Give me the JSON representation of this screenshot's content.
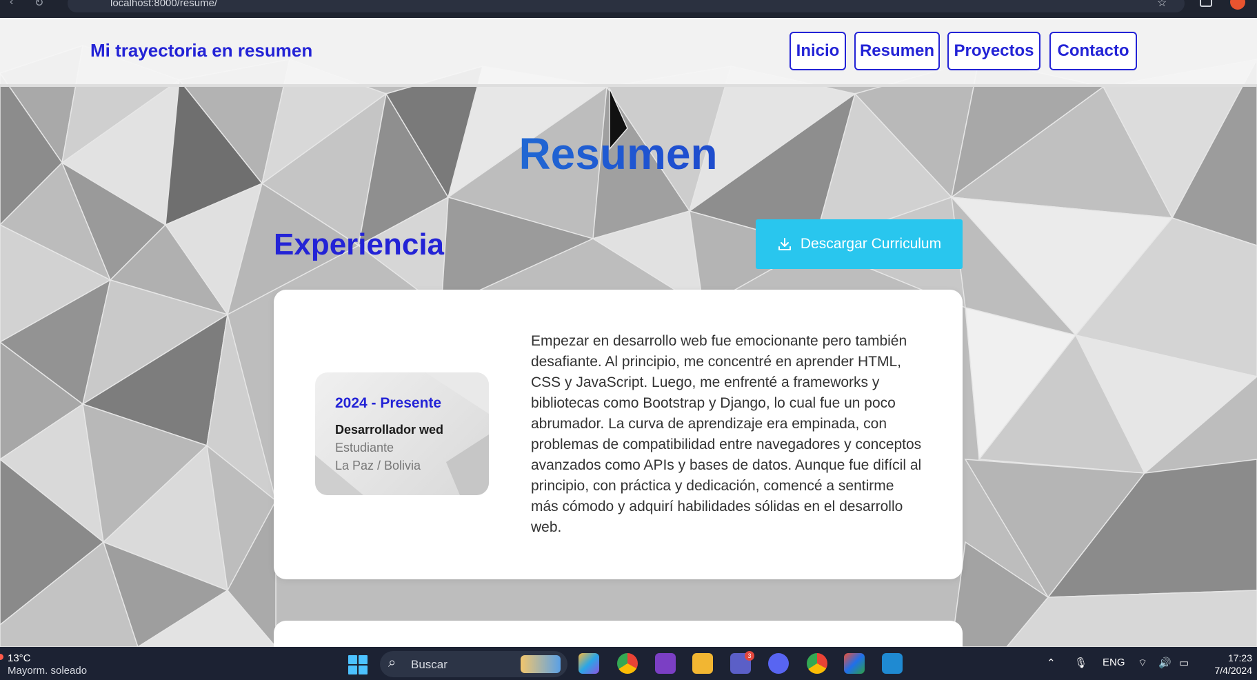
{
  "browser": {
    "url": "localhost:8000/resume/"
  },
  "header": {
    "brand": "Mi trayectoria en resumen",
    "nav": [
      "Inicio",
      "Resumen",
      "Proyectos",
      "Contacto"
    ]
  },
  "main": {
    "title": "Resumen",
    "section_title": "Experiencia",
    "download_label": "Descargar Curriculum"
  },
  "experience": [
    {
      "period": "2024 - Presente",
      "role": "Desarrollador wed",
      "status": "Estudiante",
      "place": "La Paz / Bolivia",
      "description": "Empezar en desarrollo web fue emocionante pero también desafiante. Al principio, me concentré en aprender HTML, CSS y JavaScript. Luego, me enfrenté a frameworks y bibliotecas como Bootstrap y Django, lo cual fue un poco abrumador. La curva de aprendizaje era empinada, con problemas de compatibilidad entre navegadores y conceptos avanzados como APIs y bases de datos. Aunque fue difícil al principio, con práctica y dedicación, comencé a sentirme más cómodo y adquirí habilidades sólidas en el desarrollo web."
    }
  ],
  "taskbar": {
    "weather_temp": "13°C",
    "weather_cond": "Mayorm. soleado",
    "search_label": "Buscar",
    "teams_badge": "3",
    "language": "ENG",
    "time": "17:23",
    "date": "7/4/2024"
  },
  "colors": {
    "accent": "#2323d6",
    "button": "#29c6ee",
    "taskbar": "#1c2233"
  }
}
